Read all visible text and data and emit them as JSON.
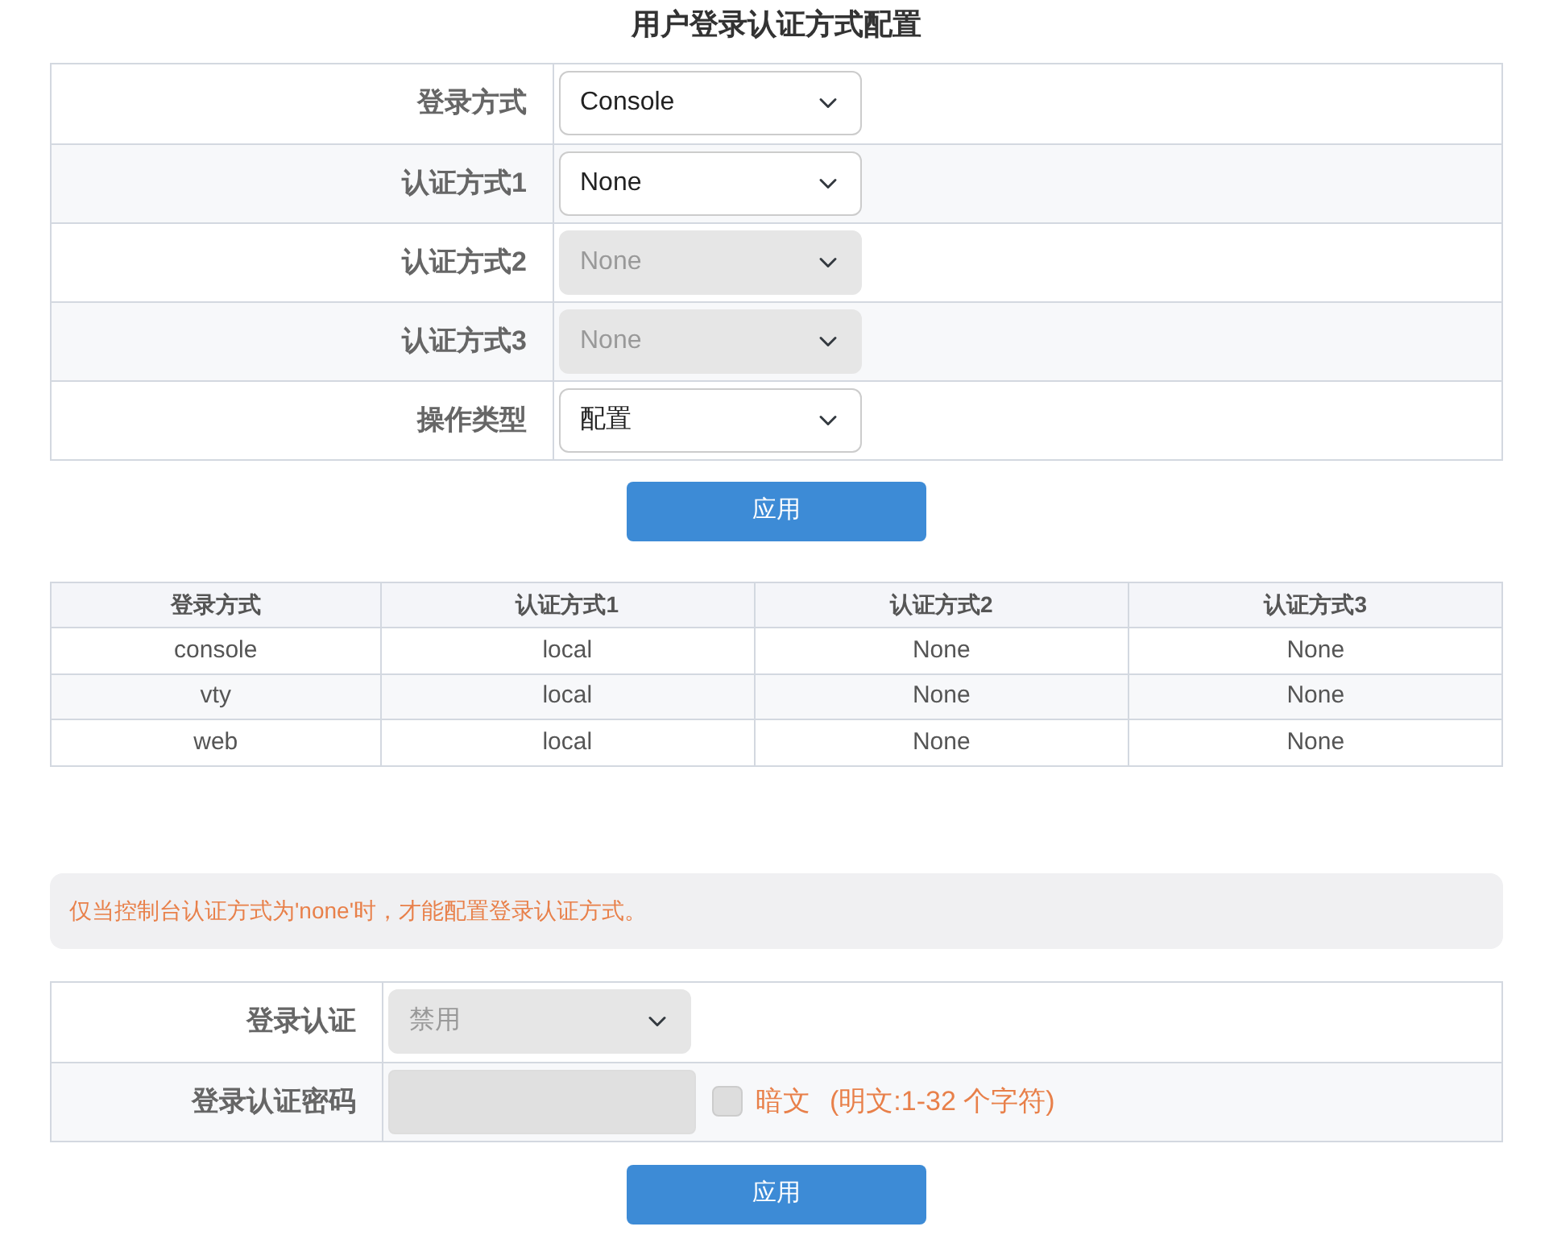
{
  "title": "用户登录认证方式配置",
  "form": {
    "rows": [
      {
        "label": "登录方式",
        "value": "Console",
        "disabled": false
      },
      {
        "label": "认证方式1",
        "value": "None",
        "disabled": false
      },
      {
        "label": "认证方式2",
        "value": "None",
        "disabled": true
      },
      {
        "label": "认证方式3",
        "value": "None",
        "disabled": true
      },
      {
        "label": "操作类型",
        "value": "配置",
        "disabled": false
      }
    ],
    "apply_button": "应用"
  },
  "table": {
    "columns": [
      "登录方式",
      "认证方式1",
      "认证方式2",
      "认证方式3"
    ],
    "rows": [
      [
        "console",
        "local",
        "None",
        "None"
      ],
      [
        "vty",
        "local",
        "None",
        "None"
      ],
      [
        "web",
        "local",
        "None",
        "None"
      ]
    ]
  },
  "notice": "仅当控制台认证方式为'none'时，才能配置登录认证方式。",
  "login_form": {
    "rows": [
      {
        "kind": "select",
        "label": "登录认证",
        "value": "禁用",
        "disabled": true
      },
      {
        "kind": "password",
        "label": "登录认证密码",
        "disabled": true,
        "checkbox": {
          "label": "暗文",
          "checked": false,
          "disabled": true
        },
        "hint": "(明文:1-32 个字符)"
      }
    ],
    "apply_button": "应用"
  }
}
